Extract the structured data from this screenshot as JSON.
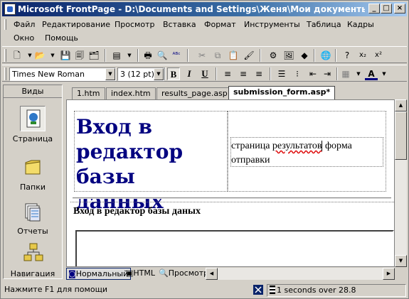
{
  "window": {
    "title": "Microsoft FrontPage - D:\\Documents and Settings\\Женя\\Мои документы\\Мои Web\\..."
  },
  "menu": [
    "Файл",
    "Редактирование",
    "Просмотр",
    "Вставка",
    "Формат",
    "Инструменты",
    "Таблица",
    "Кадры",
    "Окно",
    "Помощь"
  ],
  "format_toolbar": {
    "font": "Times New Roman",
    "size": "3  (12 pt)",
    "bold": "B",
    "italic": "I",
    "underline": "U"
  },
  "views": {
    "header": "Виды",
    "items": [
      "Страница",
      "Папки",
      "Отчеты",
      "Навигация"
    ]
  },
  "tabs": [
    "1.htm",
    "index.htm",
    "results_page.asp",
    "submission_form.asp*"
  ],
  "document": {
    "big_title": "Вход в редактор базы данных",
    "caption_pre": "страница ",
    "caption_err": "результатов",
    "caption_post": " форма отправки",
    "subtitle": "Вход в редактор базы даных"
  },
  "modes": [
    "Нормальный",
    "HTML",
    "Просмотр"
  ],
  "status": {
    "help": "Нажмите F1 для помощи",
    "timing": "1 seconds over 28.8"
  },
  "colors": {
    "title_gradient_start": "#0a246a",
    "heading_color": "#000080"
  }
}
